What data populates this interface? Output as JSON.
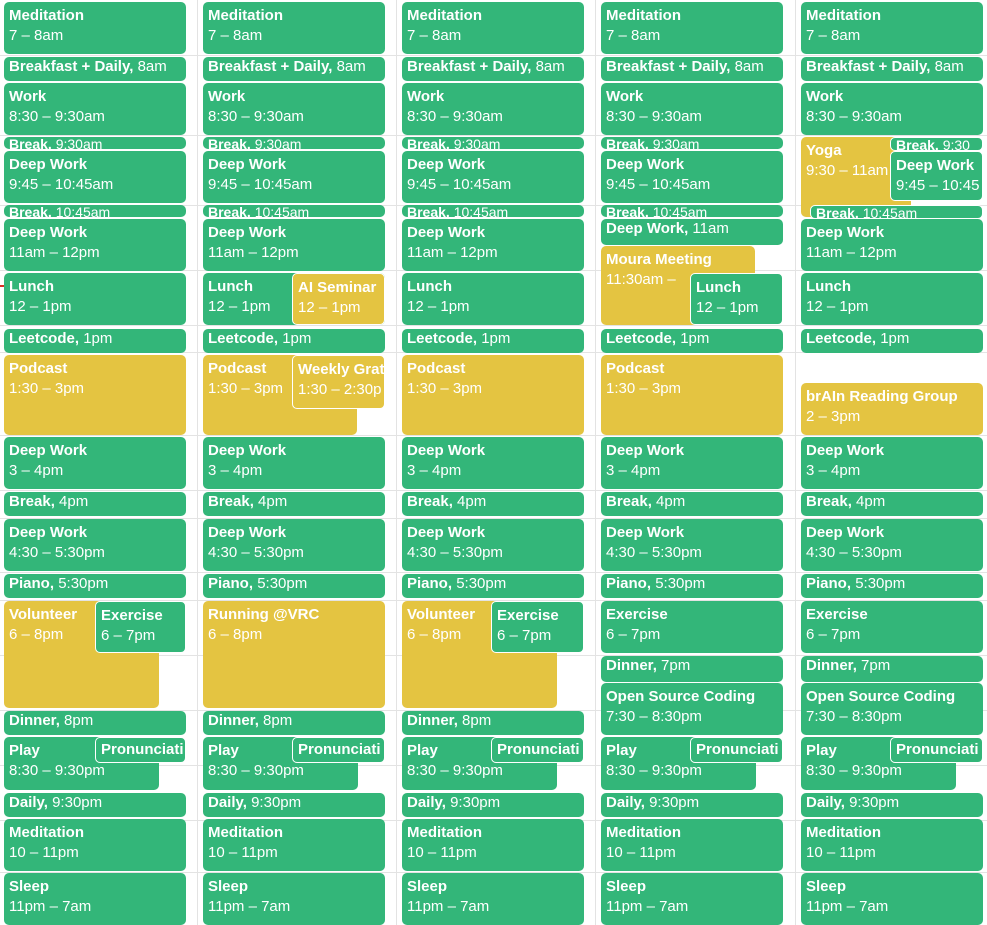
{
  "colors": {
    "green": "#33b679",
    "yellow": "#e4c441"
  },
  "days": [
    {
      "events": [
        {
          "title": "Meditation",
          "time": "7 – 8am",
          "color": "green",
          "style": "block"
        },
        {
          "title": "Breakfast + Daily",
          "time": "8am",
          "color": "green",
          "style": "inline"
        },
        {
          "title": "Work",
          "time": "8:30 – 9:30am",
          "color": "green",
          "style": "block"
        },
        {
          "title": "Break",
          "time": "9:30am",
          "color": "green",
          "style": "tiny"
        },
        {
          "title": "Deep Work",
          "time": "9:45 – 10:45am",
          "color": "green",
          "style": "block"
        },
        {
          "title": "Break",
          "time": "10:45am",
          "color": "green",
          "style": "tiny"
        },
        {
          "title": "Deep Work",
          "time": "11am – 12pm",
          "color": "green",
          "style": "block"
        },
        {
          "title": "Lunch",
          "time": "12 – 1pm",
          "color": "green",
          "style": "block"
        },
        {
          "title": "Leetcode",
          "time": "1pm",
          "color": "green",
          "style": "inline"
        },
        {
          "title": "Podcast",
          "time": "1:30 – 3pm",
          "color": "yellow",
          "style": "block"
        },
        {
          "title": "Deep Work",
          "time": "3 – 4pm",
          "color": "green",
          "style": "block"
        },
        {
          "title": "Break",
          "time": "4pm",
          "color": "green",
          "style": "inline"
        },
        {
          "title": "Deep Work",
          "time": "4:30 – 5:30pm",
          "color": "green",
          "style": "block"
        },
        {
          "title": "Piano",
          "time": "5:30pm",
          "color": "green",
          "style": "inline"
        },
        {
          "title": "Volunteer",
          "time": "6 – 8pm",
          "color": "yellow",
          "style": "block"
        },
        {
          "title": "Exercise",
          "time": "6 – 7pm",
          "color": "green",
          "style": "block"
        },
        {
          "title": "Dinner",
          "time": "8pm",
          "color": "green",
          "style": "inline"
        },
        {
          "title": "Play",
          "time": "8:30 – 9:30pm",
          "color": "green",
          "style": "block"
        },
        {
          "title": "Pronunciati",
          "time": "",
          "color": "green",
          "style": "block"
        },
        {
          "title": "Daily",
          "time": "9:30pm",
          "color": "green",
          "style": "inline"
        },
        {
          "title": "Meditation",
          "time": "10 – 11pm",
          "color": "green",
          "style": "block"
        },
        {
          "title": "Sleep",
          "time": "11pm – 7am",
          "color": "green",
          "style": "block"
        }
      ]
    },
    {
      "events": [
        {
          "title": "Meditation",
          "time": "7 – 8am",
          "color": "green",
          "style": "block"
        },
        {
          "title": "Breakfast + Daily",
          "time": "8am",
          "color": "green",
          "style": "inline"
        },
        {
          "title": "Work",
          "time": "8:30 – 9:30am",
          "color": "green",
          "style": "block"
        },
        {
          "title": "Break",
          "time": "9:30am",
          "color": "green",
          "style": "tiny"
        },
        {
          "title": "Deep Work",
          "time": "9:45 – 10:45am",
          "color": "green",
          "style": "block"
        },
        {
          "title": "Break",
          "time": "10:45am",
          "color": "green",
          "style": "tiny"
        },
        {
          "title": "Deep Work",
          "time": "11am – 12pm",
          "color": "green",
          "style": "block"
        },
        {
          "title": "Lunch",
          "time": "12 – 1pm",
          "color": "green",
          "style": "block"
        },
        {
          "title": "AI Seminar",
          "time": "12 – 1pm",
          "color": "yellow",
          "style": "block"
        },
        {
          "title": "Leetcode",
          "time": "1pm",
          "color": "green",
          "style": "inline"
        },
        {
          "title": "Podcast",
          "time": "1:30 – 3pm",
          "color": "yellow",
          "style": "block"
        },
        {
          "title": "Weekly Grat",
          "time": "1:30 – 2:30p",
          "color": "yellow",
          "style": "block"
        },
        {
          "title": "Deep Work",
          "time": "3 – 4pm",
          "color": "green",
          "style": "block"
        },
        {
          "title": "Break",
          "time": "4pm",
          "color": "green",
          "style": "inline"
        },
        {
          "title": "Deep Work",
          "time": "4:30 – 5:30pm",
          "color": "green",
          "style": "block"
        },
        {
          "title": "Piano",
          "time": "5:30pm",
          "color": "green",
          "style": "inline"
        },
        {
          "title": "Running @VRC",
          "time": "6 – 8pm",
          "color": "yellow",
          "style": "block"
        },
        {
          "title": "Dinner",
          "time": "8pm",
          "color": "green",
          "style": "inline"
        },
        {
          "title": "Play",
          "time": "8:30 – 9:30pm",
          "color": "green",
          "style": "block"
        },
        {
          "title": "Pronunciati",
          "time": "",
          "color": "green",
          "style": "block"
        },
        {
          "title": "Daily",
          "time": "9:30pm",
          "color": "green",
          "style": "inline"
        },
        {
          "title": "Meditation",
          "time": "10 – 11pm",
          "color": "green",
          "style": "block"
        },
        {
          "title": "Sleep",
          "time": "11pm – 7am",
          "color": "green",
          "style": "block"
        }
      ]
    },
    {
      "events": [
        {
          "title": "Meditation",
          "time": "7 – 8am",
          "color": "green",
          "style": "block"
        },
        {
          "title": "Breakfast + Daily",
          "time": "8am",
          "color": "green",
          "style": "inline"
        },
        {
          "title": "Work",
          "time": "8:30 – 9:30am",
          "color": "green",
          "style": "block"
        },
        {
          "title": "Break",
          "time": "9:30am",
          "color": "green",
          "style": "tiny"
        },
        {
          "title": "Deep Work",
          "time": "9:45 – 10:45am",
          "color": "green",
          "style": "block"
        },
        {
          "title": "Break",
          "time": "10:45am",
          "color": "green",
          "style": "tiny"
        },
        {
          "title": "Deep Work",
          "time": "11am – 12pm",
          "color": "green",
          "style": "block"
        },
        {
          "title": "Lunch",
          "time": "12 – 1pm",
          "color": "green",
          "style": "block"
        },
        {
          "title": "Leetcode",
          "time": "1pm",
          "color": "green",
          "style": "inline"
        },
        {
          "title": "Podcast",
          "time": "1:30 – 3pm",
          "color": "yellow",
          "style": "block"
        },
        {
          "title": "Deep Work",
          "time": "3 – 4pm",
          "color": "green",
          "style": "block"
        },
        {
          "title": "Break",
          "time": "4pm",
          "color": "green",
          "style": "inline"
        },
        {
          "title": "Deep Work",
          "time": "4:30 – 5:30pm",
          "color": "green",
          "style": "block"
        },
        {
          "title": "Piano",
          "time": "5:30pm",
          "color": "green",
          "style": "inline"
        },
        {
          "title": "Volunteer",
          "time": "6 – 8pm",
          "color": "yellow",
          "style": "block"
        },
        {
          "title": "Exercise",
          "time": "6 – 7pm",
          "color": "green",
          "style": "block"
        },
        {
          "title": "Dinner",
          "time": "8pm",
          "color": "green",
          "style": "inline"
        },
        {
          "title": "Play",
          "time": "8:30 – 9:30pm",
          "color": "green",
          "style": "block"
        },
        {
          "title": "Pronunciati",
          "time": "",
          "color": "green",
          "style": "block"
        },
        {
          "title": "Daily",
          "time": "9:30pm",
          "color": "green",
          "style": "inline"
        },
        {
          "title": "Meditation",
          "time": "10 – 11pm",
          "color": "green",
          "style": "block"
        },
        {
          "title": "Sleep",
          "time": "11pm – 7am",
          "color": "green",
          "style": "block"
        }
      ]
    },
    {
      "events": [
        {
          "title": "Meditation",
          "time": "7 – 8am",
          "color": "green",
          "style": "block"
        },
        {
          "title": "Breakfast + Daily",
          "time": "8am",
          "color": "green",
          "style": "inline"
        },
        {
          "title": "Work",
          "time": "8:30 – 9:30am",
          "color": "green",
          "style": "block"
        },
        {
          "title": "Break",
          "time": "9:30am",
          "color": "green",
          "style": "tiny"
        },
        {
          "title": "Deep Work",
          "time": "9:45 – 10:45am",
          "color": "green",
          "style": "block"
        },
        {
          "title": "Break",
          "time": "10:45am",
          "color": "green",
          "style": "tiny"
        },
        {
          "title": "Deep Work",
          "time": "11am",
          "color": "green",
          "style": "inline"
        },
        {
          "title": "Moura Meeting",
          "time": "11:30am –",
          "color": "yellow",
          "style": "block"
        },
        {
          "title": "Lunch",
          "time": "12 – 1pm",
          "color": "green",
          "style": "block"
        },
        {
          "title": "Leetcode",
          "time": "1pm",
          "color": "green",
          "style": "inline"
        },
        {
          "title": "Podcast",
          "time": "1:30 – 3pm",
          "color": "yellow",
          "style": "block"
        },
        {
          "title": "Deep Work",
          "time": "3 – 4pm",
          "color": "green",
          "style": "block"
        },
        {
          "title": "Break",
          "time": "4pm",
          "color": "green",
          "style": "inline"
        },
        {
          "title": "Deep Work",
          "time": "4:30 – 5:30pm",
          "color": "green",
          "style": "block"
        },
        {
          "title": "Piano",
          "time": "5:30pm",
          "color": "green",
          "style": "inline"
        },
        {
          "title": "Exercise",
          "time": "6 – 7pm",
          "color": "green",
          "style": "block"
        },
        {
          "title": "Dinner",
          "time": "7pm",
          "color": "green",
          "style": "inline"
        },
        {
          "title": "Open Source Coding",
          "time": "7:30 – 8:30pm",
          "color": "green",
          "style": "block"
        },
        {
          "title": "Play",
          "time": "8:30 – 9:30pm",
          "color": "green",
          "style": "block"
        },
        {
          "title": "Pronunciati",
          "time": "",
          "color": "green",
          "style": "block"
        },
        {
          "title": "Daily",
          "time": "9:30pm",
          "color": "green",
          "style": "inline"
        },
        {
          "title": "Meditation",
          "time": "10 – 11pm",
          "color": "green",
          "style": "block"
        },
        {
          "title": "Sleep",
          "time": "11pm – 7am",
          "color": "green",
          "style": "block"
        }
      ]
    },
    {
      "events": [
        {
          "title": "Meditation",
          "time": "7 – 8am",
          "color": "green",
          "style": "block"
        },
        {
          "title": "Breakfast + Daily",
          "time": "8am",
          "color": "green",
          "style": "inline"
        },
        {
          "title": "Work",
          "time": "8:30 – 9:30am",
          "color": "green",
          "style": "block"
        },
        {
          "title": "Yoga",
          "time": "9:30 – 11am",
          "color": "yellow",
          "style": "block"
        },
        {
          "title": "Break",
          "time": "9:30",
          "color": "green",
          "style": "tiny"
        },
        {
          "title": "Deep Work",
          "time": "9:45 – 10:45",
          "color": "green",
          "style": "block"
        },
        {
          "title": "Break",
          "time": "10:45am",
          "color": "green",
          "style": "tiny"
        },
        {
          "title": "Deep Work",
          "time": "11am – 12pm",
          "color": "green",
          "style": "block"
        },
        {
          "title": "Lunch",
          "time": "12 – 1pm",
          "color": "green",
          "style": "block"
        },
        {
          "title": "Leetcode",
          "time": "1pm",
          "color": "green",
          "style": "inline"
        },
        {
          "title": "brAIn Reading Group",
          "time": "2 – 3pm",
          "color": "yellow",
          "style": "block"
        },
        {
          "title": "Deep Work",
          "time": "3 – 4pm",
          "color": "green",
          "style": "block"
        },
        {
          "title": "Break",
          "time": "4pm",
          "color": "green",
          "style": "inline"
        },
        {
          "title": "Deep Work",
          "time": "4:30 – 5:30pm",
          "color": "green",
          "style": "block"
        },
        {
          "title": "Piano",
          "time": "5:30pm",
          "color": "green",
          "style": "inline"
        },
        {
          "title": "Exercise",
          "time": "6 – 7pm",
          "color": "green",
          "style": "block"
        },
        {
          "title": "Dinner",
          "time": "7pm",
          "color": "green",
          "style": "inline"
        },
        {
          "title": "Open Source Coding",
          "time": "7:30 – 8:30pm",
          "color": "green",
          "style": "block"
        },
        {
          "title": "Play",
          "time": "8:30 – 9:30pm",
          "color": "green",
          "style": "block"
        },
        {
          "title": "Pronunciati",
          "time": "",
          "color": "green",
          "style": "block"
        },
        {
          "title": "Daily",
          "time": "9:30pm",
          "color": "green",
          "style": "inline"
        },
        {
          "title": "Meditation",
          "time": "10 – 11pm",
          "color": "green",
          "style": "block"
        },
        {
          "title": "Sleep",
          "time": "11pm – 7am",
          "color": "green",
          "style": "block"
        }
      ]
    }
  ]
}
